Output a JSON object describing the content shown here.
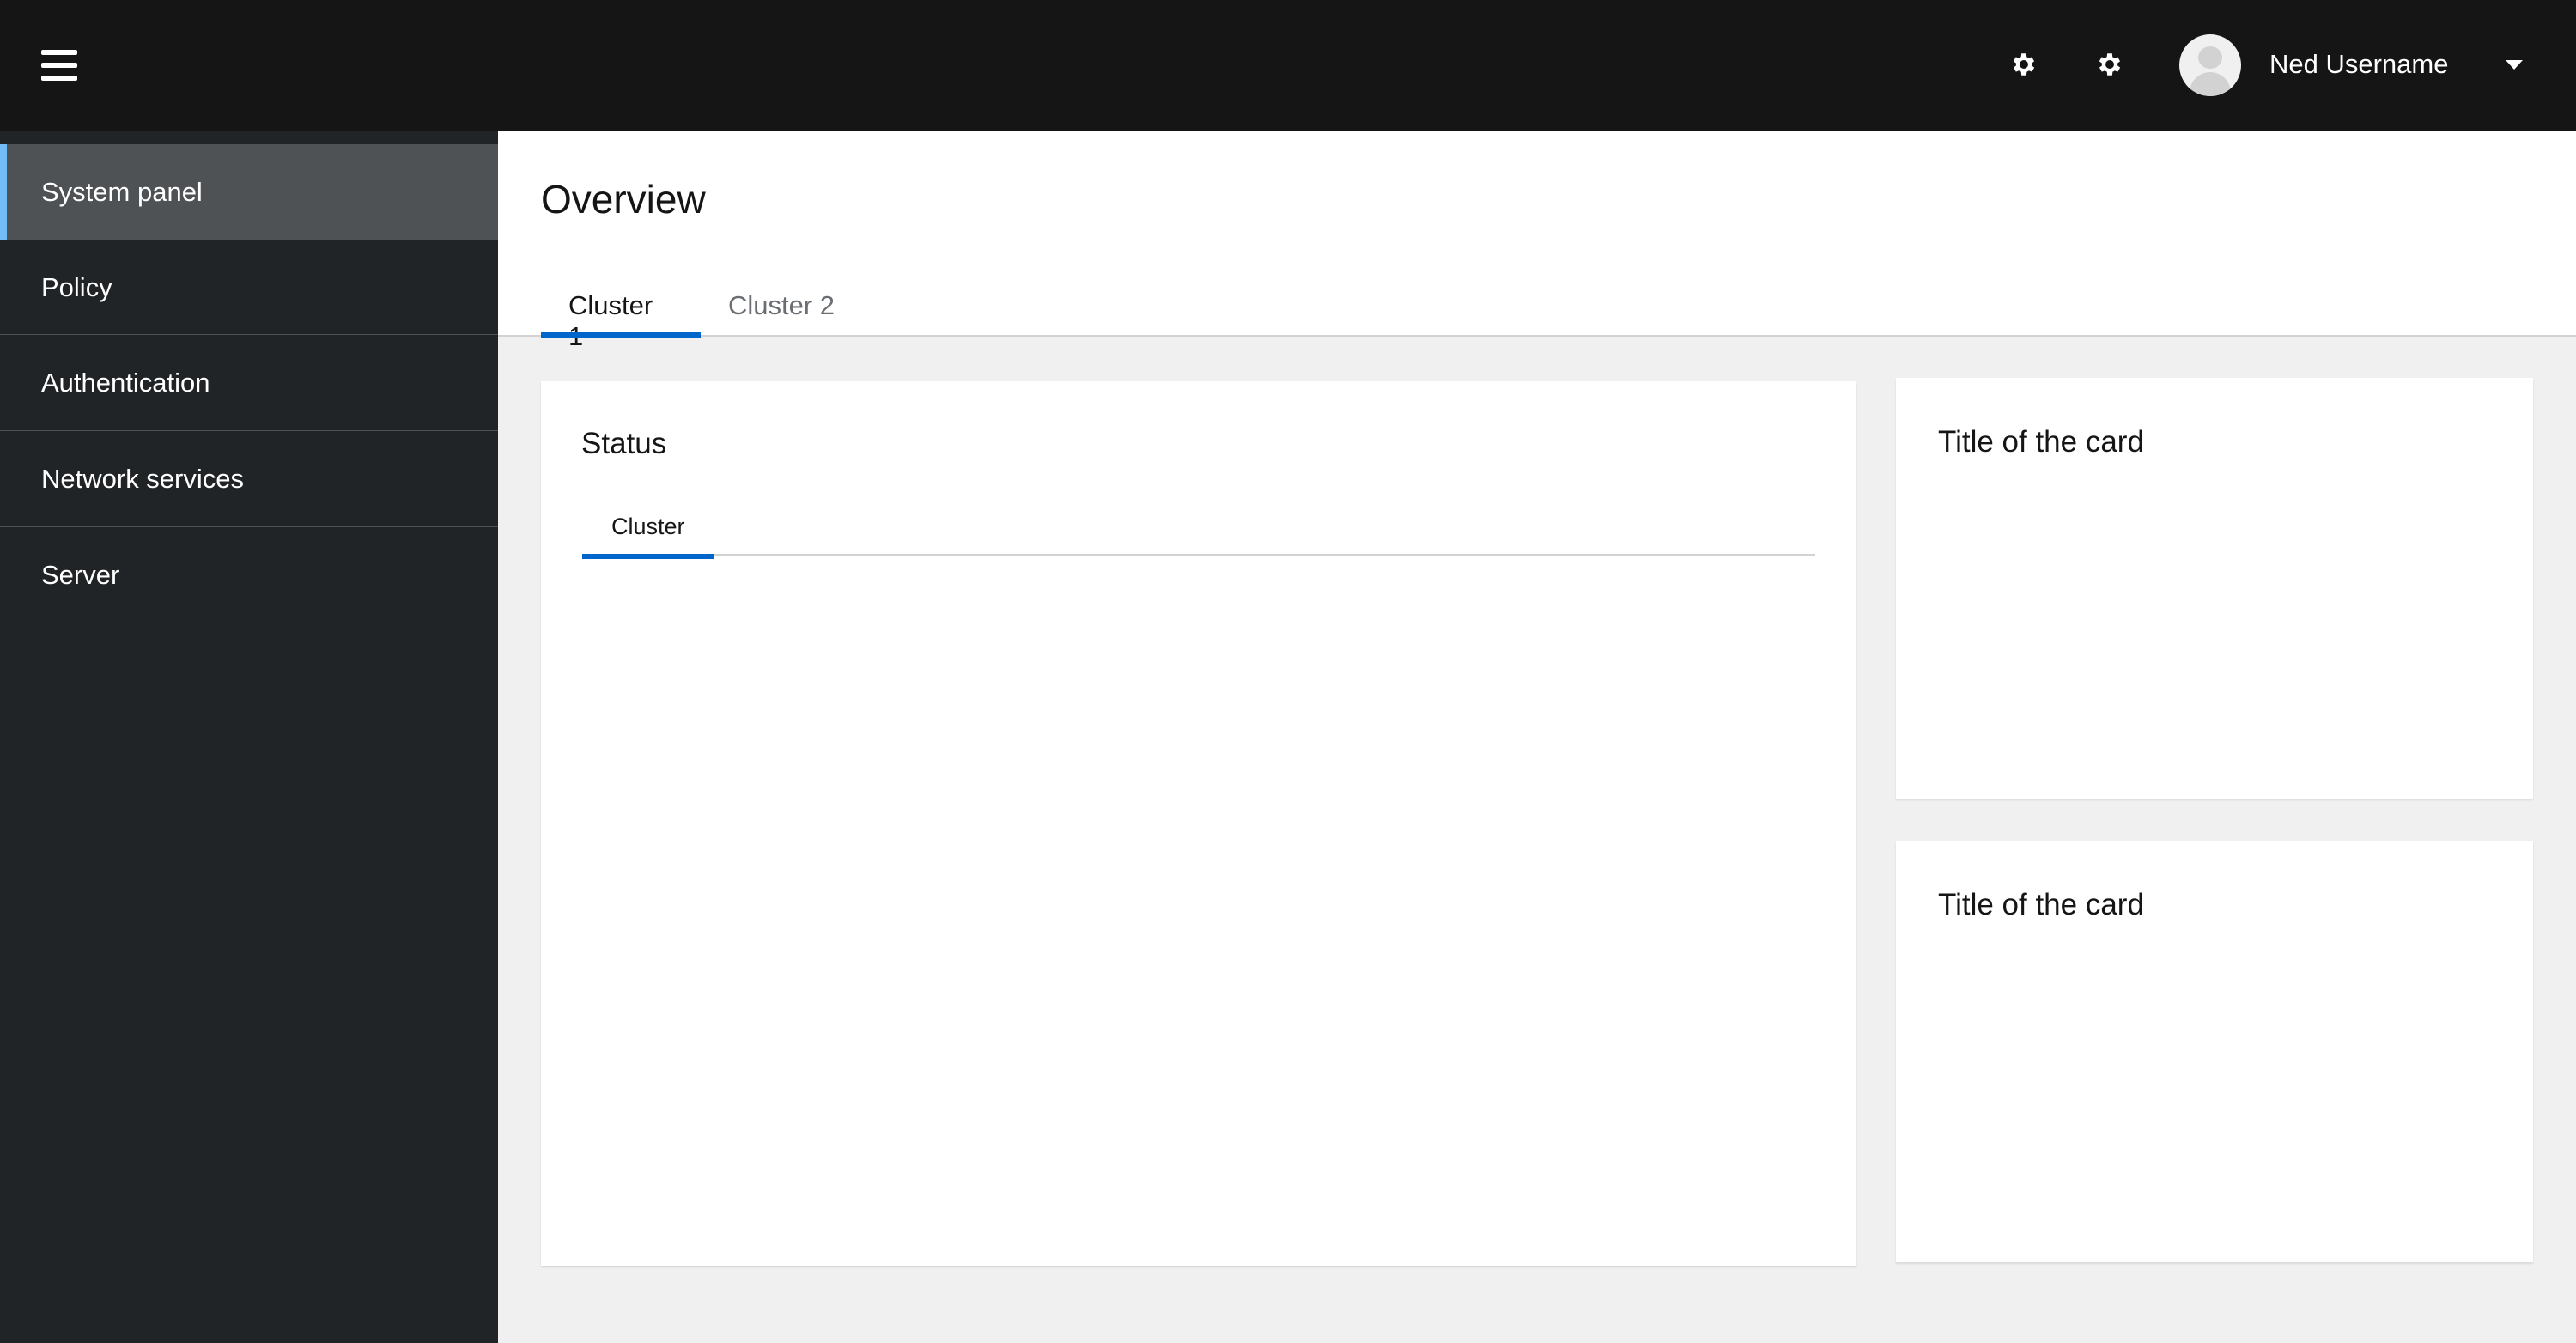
{
  "masthead": {
    "menu_icon": "hamburger-icon",
    "tools": [
      {
        "icon": "gear-icon",
        "label": "Settings"
      },
      {
        "icon": "gear-icon",
        "label": "Settings"
      }
    ],
    "user": {
      "avatar_icon": "avatar-icon",
      "name": "Ned Username",
      "dropdown_icon": "caret-down-icon"
    }
  },
  "sidebar": {
    "items": [
      {
        "label": "System panel",
        "active": true
      },
      {
        "label": "Policy",
        "active": false
      },
      {
        "label": "Authentication",
        "active": false
      },
      {
        "label": "Network services",
        "active": false
      },
      {
        "label": "Server",
        "active": false
      }
    ]
  },
  "page": {
    "title": "Overview",
    "tabs": [
      {
        "label": "Cluster 1",
        "active": true
      },
      {
        "label": "Cluster 2",
        "active": false
      }
    ]
  },
  "cards": {
    "status": {
      "title": "Status",
      "tabs": [
        {
          "label": "Cluster",
          "active": true
        }
      ]
    },
    "right": [
      {
        "title": "Title of the card"
      },
      {
        "title": "Title of the card"
      }
    ]
  },
  "colors": {
    "masthead_bg": "#151515",
    "sidebar_bg": "#212427",
    "sidebar_active_bg": "#4f5255",
    "sidebar_active_accent": "#73bcf7",
    "tab_active_accent": "#0066cc",
    "page_bg": "#f0f0f0"
  }
}
